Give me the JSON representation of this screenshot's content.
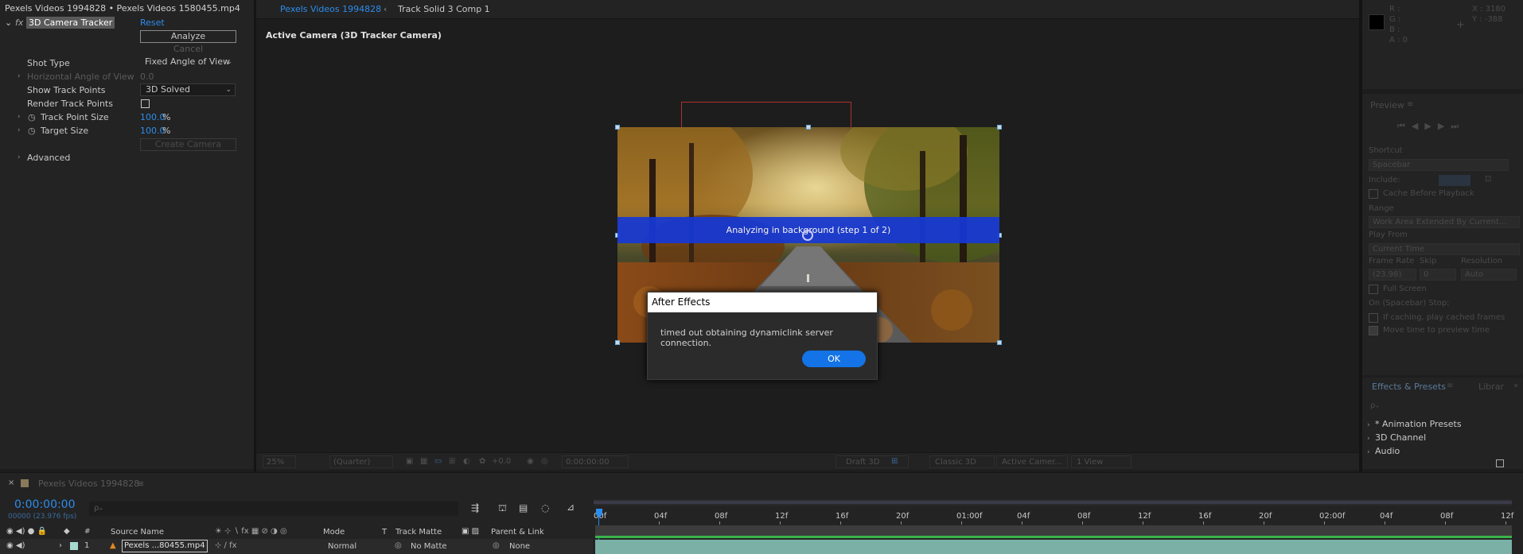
{
  "effect_controls": {
    "title": "Pexels Videos 1994828 • Pexels Videos 1580455.mp4",
    "effect_name": "3D Camera Tracker",
    "reset_label": "Reset",
    "analyze_label": "Analyze",
    "cancel_label": "Cancel",
    "shot_type_label": "Shot Type",
    "shot_type_value": "Fixed Angle of View",
    "horizontal_angle_label": "Horizontal Angle of View",
    "horizontal_angle_value": "0.0",
    "show_track_points_label": "Show Track Points",
    "show_track_points_value": "3D Solved",
    "render_track_points_label": "Render Track Points",
    "track_point_size_label": "Track Point Size",
    "track_point_size_value": "100.0",
    "target_size_label": "Target Size",
    "target_size_value": "100.0",
    "percent": "%",
    "create_camera_label": "Create Camera",
    "advanced_label": "Advanced"
  },
  "composition": {
    "tab_active": "Pexels Videos 1994828",
    "tab_other": "Track Solid 3 Comp 1",
    "view_label": "Active Camera (3D Tracker Camera)",
    "analyzing_text": "Analyzing in background (step 1 of 2)",
    "viewer_bar": {
      "zoom": "25%",
      "resolution": "(Quarter)",
      "exposure": "+0.0",
      "timecode": "0:00:00:00",
      "renderer_draft": "Draft 3D",
      "renderer": "Classic 3D",
      "camera": "Active Camer...",
      "views": "1 View"
    }
  },
  "dialog": {
    "title": "After Effects",
    "message": "timed out obtaining dynamiclink server connection.",
    "ok_label": "OK"
  },
  "info": {
    "r": "R :",
    "g": "G :",
    "b": "B :",
    "a": "A : 0",
    "x": "X : 3180",
    "y": "Y : -388"
  },
  "preview": {
    "title": "Preview",
    "shortcut_label": "Shortcut",
    "shortcut_value": "Spacebar",
    "include_label": "Include:",
    "cache_label": "Cache Before Playback",
    "range_label": "Range",
    "range_value": "Work Area Extended By Current...",
    "play_from_label": "Play From",
    "play_from_value": "Current Time",
    "frame_rate_label": "Frame Rate",
    "skip_label": "Skip",
    "resolution_label": "Resolution",
    "frame_rate_value": "(23.98)",
    "skip_value": "0",
    "resolution_value": "Auto",
    "full_screen_label": "Full Screen",
    "on_stop_label": "On (Spacebar) Stop:",
    "if_caching_label": "If caching, play cached frames",
    "move_time_label": "Move time to preview time"
  },
  "effects_presets": {
    "tab_label": "Effects & Presets",
    "libraries_label": "Librar",
    "items": [
      "* Animation Presets",
      "3D Channel",
      "Audio"
    ]
  },
  "timeline": {
    "comp_name": "Pexels Videos 1994828",
    "timecode": "0:00:00:00",
    "frames": "00000 (23.976 fps)",
    "search_placeholder": "ρ₊",
    "col_source_name": "Source Name",
    "col_mode": "Mode",
    "col_t": "T",
    "col_track_matte": "Track Matte",
    "col_parent": "Parent & Link",
    "layer_index": "1",
    "layer_name": "Pexels ...80455.mp4",
    "layer_mode": "Normal",
    "layer_matte": "No Matte",
    "layer_parent": "None",
    "ruler_labels": [
      "00f",
      "04f",
      "08f",
      "12f",
      "16f",
      "20f",
      "01:00f",
      "04f",
      "08f",
      "12f",
      "16f",
      "20f",
      "02:00f",
      "04f",
      "08f",
      "12f"
    ]
  },
  "colors": {
    "accent_blue": "#2d8ceb",
    "analyze_bar": "#1638d4",
    "ok_button": "#1473e6",
    "track_green": "#3ab44a",
    "layer_bar": "#7ab0a6"
  }
}
